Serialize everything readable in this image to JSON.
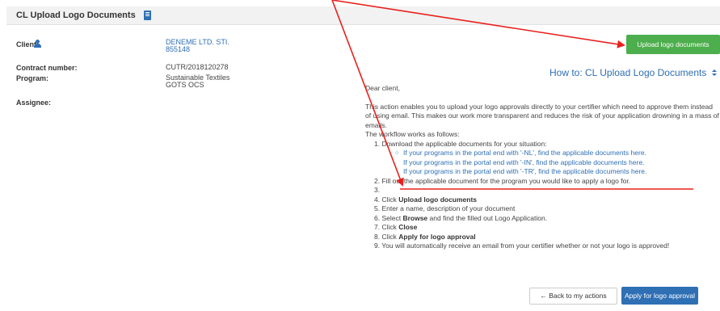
{
  "header": {
    "title": "CL Upload Logo Documents",
    "icon": "document-icon"
  },
  "details": {
    "client_label": "Client:",
    "client_name": "DENEME LTD. STI.",
    "client_id": "855148",
    "contract_label": "Contract number:",
    "contract_value": "CUTR/2018120278",
    "program_label": "Program:",
    "program_line1": "Sustainable Textiles",
    "program_line2": "GOTS OCS",
    "assignee_label": "Assignee:"
  },
  "actions": {
    "upload_label": "Upload logo documents",
    "back_label": "← Back to my actions",
    "apply_label": "Apply for logo approval ✔"
  },
  "howto": {
    "title": "How to: CL Upload Logo Documents",
    "greeting": "Dear client,",
    "intro": "This action enables you to upload your logo approvals directly to your certifier which need to approve them instead of using email. This makes our work more transparent and reduces the risk of your application drowning in a mass of emails.",
    "workflow": "The workflow works as follows:",
    "step1": "1. Download the applicable documents for your situation:",
    "links": [
      "If your programs in the portal end with '-NL', find the applicable documents here.",
      "If your programs in the portal end with '-IN', find the applicable documents here.",
      "If your programs in the portal end with '-TR', find the applicable documents here."
    ],
    "step2": "2. Fill out the applicable document for the program you would like to apply a logo for.",
    "step3": "3.",
    "step4_prefix": "4. Click ",
    "step4_bold": "Upload logo documents",
    "step5": "5. Enter a name, description of your document",
    "step6_prefix": "6. Select ",
    "step6_bold": "Browse",
    "step6_suffix": " and find the filled out Logo Application.",
    "step7_prefix": "7. Click ",
    "step7_bold": "Close",
    "step8_prefix": "8. Click ",
    "step8_bold": "Apply for logo approval",
    "step9": "9. You will automatically receive an email from your certifier whether or not your logo is approved!"
  },
  "colors": {
    "accent": "#2f6fb4",
    "success": "#4cae4c",
    "annotation": "#e8201c"
  }
}
